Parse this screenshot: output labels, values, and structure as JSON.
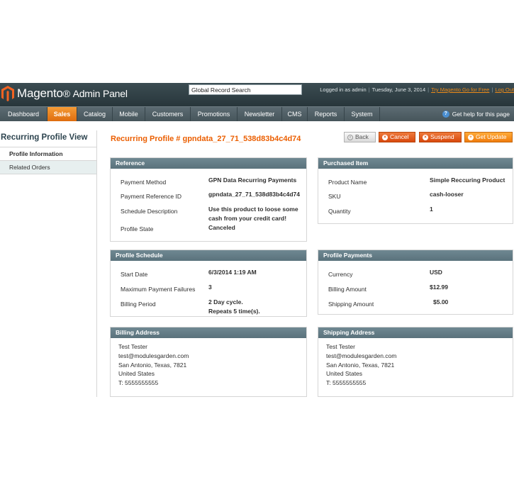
{
  "header": {
    "logo_brand": "Magento",
    "logo_sub": "Admin Panel",
    "search_value": "Global Record Search",
    "logged_in": "Logged in as admin",
    "date": "Tuesday, June 3, 2014",
    "try_link": "Try Magento Go for Free",
    "logout_link": "Log Out"
  },
  "nav": {
    "items": [
      "Dashboard",
      "Sales",
      "Catalog",
      "Mobile",
      "Customers",
      "Promotions",
      "Newsletter",
      "CMS",
      "Reports",
      "System"
    ],
    "active": "Sales",
    "help": "Get help for this page"
  },
  "sidebar": {
    "title": "Recurring Profile View",
    "tabs": [
      "Profile Information",
      "Related Orders"
    ]
  },
  "page": {
    "title": "Recurring Profile # gpndata_27_71_538d83b4c4d74",
    "buttons": {
      "back": "Back",
      "cancel": "Cancel",
      "suspend": "Suspend",
      "update": "Get Update"
    }
  },
  "reference": {
    "title": "Reference",
    "payment_method_label": "Payment Method",
    "payment_method_value": "GPN Data Recurring Payments",
    "payment_ref_label": "Payment Reference ID",
    "payment_ref_value": "gpndata_27_71_538d83b4c4d74",
    "schedule_desc_label": "Schedule Description",
    "schedule_desc_line1": "Use this product to loose some",
    "schedule_desc_line2": "cash from your credit card!",
    "profile_state_label": "Profile State",
    "profile_state_value": "Canceled"
  },
  "purchased": {
    "title": "Purchased Item",
    "product_name_label": "Product Name",
    "product_name_value": "Simple Reccuring Product",
    "sku_label": "SKU",
    "sku_value": "cash-looser",
    "quantity_label": "Quantity",
    "quantity_value": "1"
  },
  "schedule": {
    "title": "Profile Schedule",
    "start_label": "Start Date",
    "start_value": "6/3/2014 1:19 AM",
    "max_fail_label": "Maximum Payment Failures",
    "max_fail_value": "3",
    "billing_period_label": "Billing Period",
    "billing_period_line1": "2 Day cycle.",
    "billing_period_line2": "Repeats 5 time(s)."
  },
  "payments": {
    "title": "Profile Payments",
    "currency_label": "Currency",
    "currency_value": "USD",
    "billing_amount_label": "Billing Amount",
    "billing_amount_value": "$12.99",
    "shipping_amount_label": "Shipping Amount",
    "shipping_amount_value": "$5.00"
  },
  "billing_address": {
    "title": "Billing Address",
    "lines": [
      "Test Tester",
      "test@modulesgarden.com",
      "San Antonio, Texas, 7821",
      "United States",
      "T: 5555555555"
    ]
  },
  "shipping_address": {
    "title": "Shipping Address",
    "lines": [
      "Test Tester",
      "test@modulesgarden.com",
      "San Antonio, Texas, 7821",
      "United States",
      "T: 5555555555"
    ]
  },
  "colors": {
    "accent": "#eb5e00",
    "header_bg": "#2b3a40",
    "nav_bg": "#4f5e64",
    "box_head": "#637c86",
    "tab_inactive": "#e7efef"
  }
}
